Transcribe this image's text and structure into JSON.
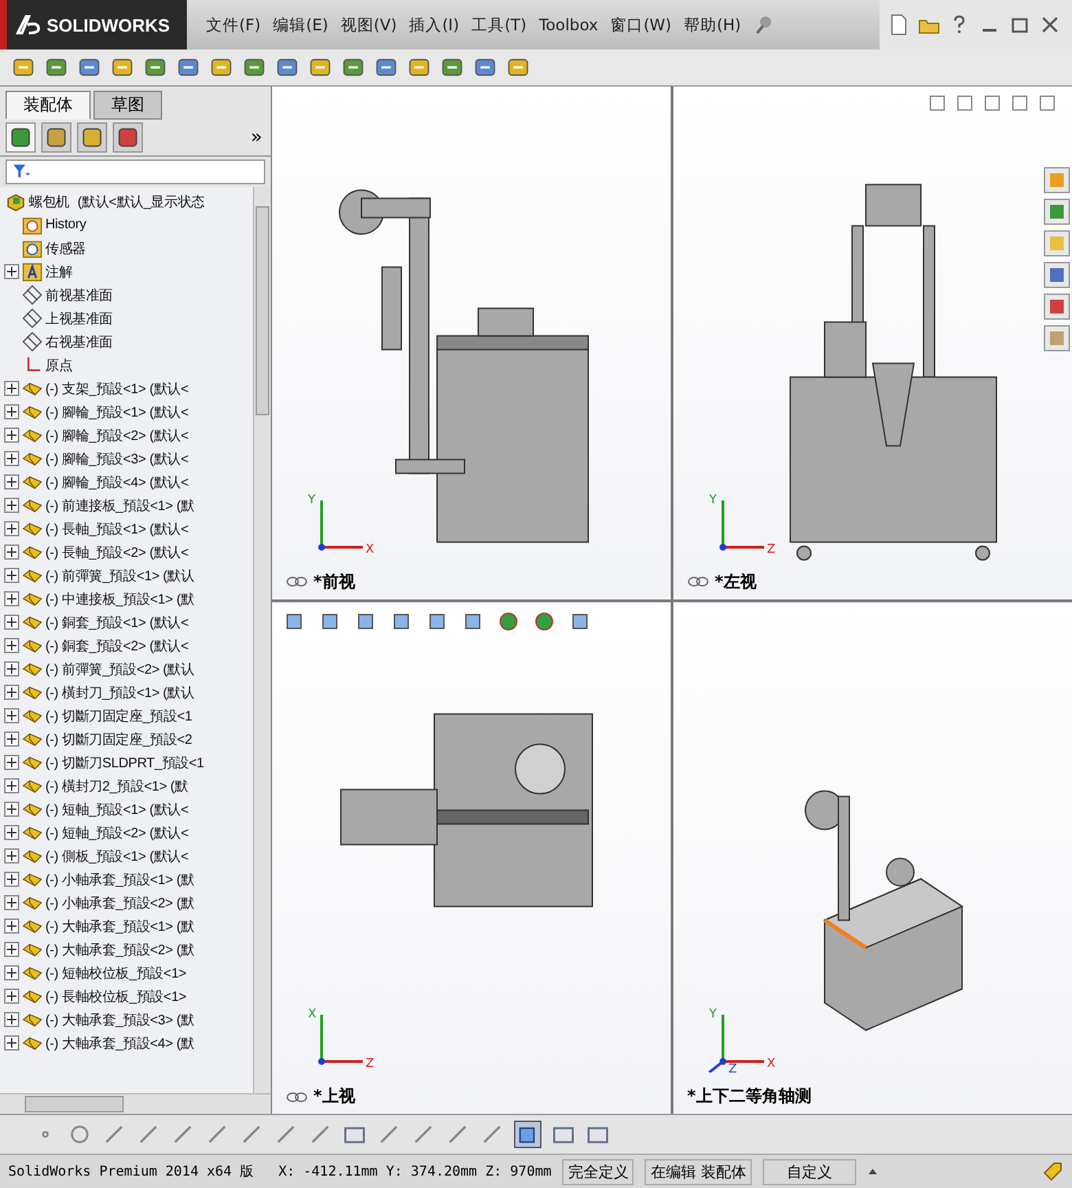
{
  "title_bar": {
    "logo": "SOLIDWORKS",
    "menus": [
      "文件(F)",
      "编辑(E)",
      "视图(V)",
      "插入(I)",
      "工具(T)",
      "Toolbox",
      "窗口(W)",
      "帮助(H)"
    ]
  },
  "panel": {
    "tabs": [
      {
        "label": "装配体",
        "selected": true
      },
      {
        "label": "草图",
        "selected": false
      }
    ],
    "more": "»",
    "tree": {
      "root": "螺包机",
      "root_config": "(默认<默认_显示状态",
      "items": [
        {
          "kind": "history",
          "text": "History"
        },
        {
          "kind": "sensor",
          "text": "传感器"
        },
        {
          "kind": "annotation",
          "text": "注解",
          "expanded": false
        },
        {
          "kind": "plane",
          "text": "前视基准面"
        },
        {
          "kind": "plane",
          "text": "上视基准面"
        },
        {
          "kind": "plane",
          "text": "右视基准面"
        },
        {
          "kind": "origin",
          "text": "原点"
        },
        {
          "kind": "part",
          "text": "(-) 支架_預設<1> (默认<",
          "expanded": false
        },
        {
          "kind": "part",
          "text": "(-) 腳輪_預設<1> (默认<",
          "expanded": false
        },
        {
          "kind": "part",
          "text": "(-) 腳輪_預設<2> (默认<",
          "expanded": false
        },
        {
          "kind": "part",
          "text": "(-) 腳輪_預設<3> (默认<",
          "expanded": false
        },
        {
          "kind": "part",
          "text": "(-) 腳輪_預設<4> (默认<",
          "expanded": false
        },
        {
          "kind": "part",
          "text": "(-) 前連接板_預設<1> (默",
          "expanded": false
        },
        {
          "kind": "part",
          "text": "(-) 長軸_預設<1> (默认<",
          "expanded": false
        },
        {
          "kind": "part",
          "text": "(-) 長軸_預設<2> (默认<",
          "expanded": false
        },
        {
          "kind": "part",
          "text": "(-) 前彈簧_預設<1> (默认",
          "expanded": false
        },
        {
          "kind": "part",
          "text": "(-) 中連接板_預設<1> (默",
          "expanded": false
        },
        {
          "kind": "part",
          "text": "(-) 銅套_預設<1> (默认<",
          "expanded": false
        },
        {
          "kind": "part",
          "text": "(-) 銅套_預設<2> (默认<",
          "expanded": false
        },
        {
          "kind": "part",
          "text": "(-) 前彈簧_預設<2> (默认",
          "expanded": false
        },
        {
          "kind": "part",
          "text": "(-) 橫封刀_預設<1> (默认",
          "expanded": false
        },
        {
          "kind": "part",
          "text": "(-) 切斷刀固定座_預設<1",
          "expanded": false
        },
        {
          "kind": "part",
          "text": "(-) 切斷刀固定座_預設<2",
          "expanded": false
        },
        {
          "kind": "part",
          "text": "(-) 切斷刀SLDPRT_預設<1",
          "expanded": false
        },
        {
          "kind": "part",
          "text": "(-) 橫封刀2_預設<1> (默",
          "expanded": false
        },
        {
          "kind": "part",
          "text": "(-) 短軸_預設<1> (默认<",
          "expanded": false
        },
        {
          "kind": "part",
          "text": "(-) 短軸_預設<2> (默认<",
          "expanded": false
        },
        {
          "kind": "part",
          "text": "(-) 側板_預設<1> (默认<",
          "expanded": false
        },
        {
          "kind": "part",
          "text": "(-) 小軸承套_預設<1> (默",
          "expanded": false
        },
        {
          "kind": "part",
          "text": "(-) 小軸承套_預設<2> (默",
          "expanded": false
        },
        {
          "kind": "part",
          "text": "(-) 大軸承套_預設<1> (默",
          "expanded": false
        },
        {
          "kind": "part",
          "text": "(-) 大軸承套_預設<2> (默",
          "expanded": false
        },
        {
          "kind": "part",
          "text": "(-) 短軸校位板_預設<1>",
          "expanded": false
        },
        {
          "kind": "part",
          "text": "(-) 長軸校位板_預設<1>",
          "expanded": false
        },
        {
          "kind": "part",
          "text": "(-) 大軸承套_預設<3> (默",
          "expanded": false
        },
        {
          "kind": "part",
          "text": "(-) 大軸承套_預設<4> (默",
          "expanded": false
        }
      ]
    }
  },
  "viewports": [
    {
      "kind": "front",
      "label": "*前视",
      "axes": [
        "Y",
        "X"
      ]
    },
    {
      "kind": "left",
      "label": "*左视",
      "axes": [
        "Y",
        "Z"
      ]
    },
    {
      "kind": "top",
      "label": "*上视",
      "axes": [
        "X",
        "Z"
      ]
    },
    {
      "kind": "iso",
      "label": "*上下二等角轴测",
      "axes": [
        "Y",
        "X",
        "Z"
      ]
    }
  ],
  "status_bar": {
    "product": "SolidWorks Premium 2014 x64 版",
    "coords": "X: -412.11mm Y: 374.20mm Z: 970mm",
    "state": "完全定义",
    "mode": "在编辑 装配体",
    "units": "自定义"
  }
}
